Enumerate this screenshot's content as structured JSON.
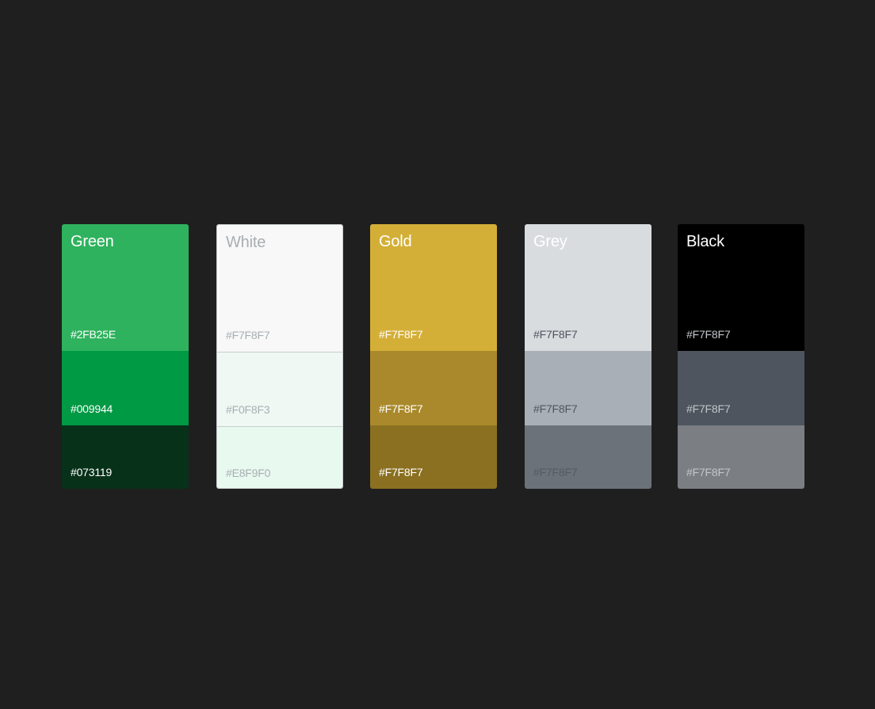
{
  "palettes": [
    {
      "name": "Green",
      "title_color": "#ffffff",
      "swatches": [
        {
          "hex": "#2FB25E",
          "fill": "#2fb25e",
          "text_color": "#ffffff"
        },
        {
          "hex": "#009944",
          "fill": "#009944",
          "text_color": "#ffffff"
        },
        {
          "hex": "#073119",
          "fill": "#073119",
          "text_color": "#ffffff"
        }
      ]
    },
    {
      "name": "White",
      "title_color": "#a9aeb3",
      "swatches": [
        {
          "hex": "#F7F8F7",
          "fill": "#f7f8f7",
          "text_color": "#a9aeb3"
        },
        {
          "hex": "#F0F8F3",
          "fill": "#f0f8f3",
          "text_color": "#a9aeb3"
        },
        {
          "hex": "#E8F9F0",
          "fill": "#e8f9f0",
          "text_color": "#a9aeb3"
        }
      ]
    },
    {
      "name": "Gold",
      "title_color": "#ffffff",
      "swatches": [
        {
          "hex": "#F7F8F7",
          "fill": "#d4af37",
          "text_color": "#ffffff"
        },
        {
          "hex": "#F7F8F7",
          "fill": "#a9892b",
          "text_color": "#ffffff"
        },
        {
          "hex": "#F7F8F7",
          "fill": "#8a7020",
          "text_color": "#ffffff"
        }
      ]
    },
    {
      "name": "Grey",
      "title_color": "#ffffff",
      "swatches": [
        {
          "hex": "#F7F8F7",
          "fill": "#d9dcdf",
          "text_color": "#4e555e"
        },
        {
          "hex": "#F7F8F7",
          "fill": "#a8afb6",
          "text_color": "#4e555e"
        },
        {
          "hex": "#F7F8F7",
          "fill": "#6b727a",
          "text_color": "#555b62"
        }
      ]
    },
    {
      "name": "Black",
      "title_color": "#ffffff",
      "swatches": [
        {
          "hex": "#F7F8F7",
          "fill": "#000000",
          "text_color": "#c2c6ca"
        },
        {
          "hex": "#F7F8F7",
          "fill": "#4e555e",
          "text_color": "#c2c6ca"
        },
        {
          "hex": "#F7F8F7",
          "fill": "#7b7f84",
          "text_color": "#c2c6ca"
        }
      ]
    }
  ]
}
